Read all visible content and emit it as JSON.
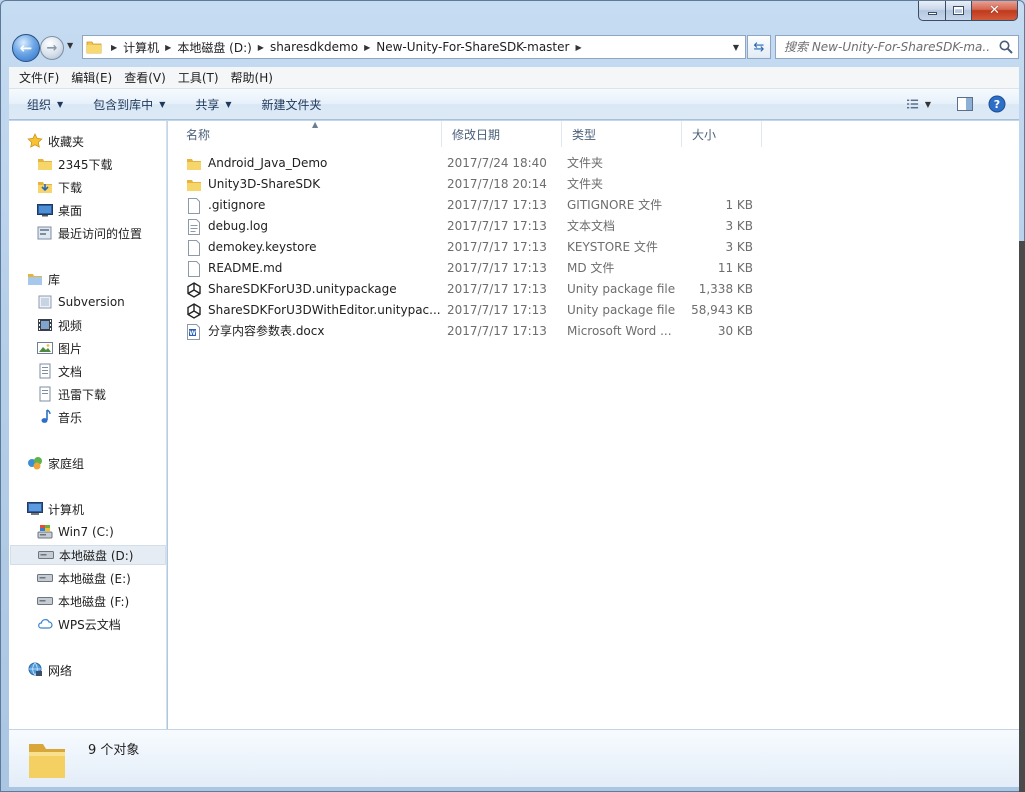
{
  "window": {
    "caption": {
      "minimize": "–",
      "maximize": "□",
      "close": "✕"
    }
  },
  "nav": {
    "back_icon": "back-arrow-icon",
    "forward_icon": "forward-arrow-icon",
    "breadcrumb": [
      "计算机",
      "本地磁盘 (D:)",
      "sharesdkdemo",
      "New-Unity-For-ShareSDK-master"
    ],
    "search_placeholder": "搜索 New-Unity-For-ShareSDK-ma..."
  },
  "menu": [
    "文件(F)",
    "编辑(E)",
    "查看(V)",
    "工具(T)",
    "帮助(H)"
  ],
  "commands": {
    "organize": "组织",
    "include_in_library": "包含到库中",
    "share": "共享",
    "new_folder": "新建文件夹"
  },
  "sidebar": {
    "favorites": {
      "label": "收藏夹",
      "items": [
        {
          "label": "2345下载",
          "icon": "folder-icon"
        },
        {
          "label": "下载",
          "icon": "downloads-folder-icon"
        },
        {
          "label": "桌面",
          "icon": "desktop-icon"
        },
        {
          "label": "最近访问的位置",
          "icon": "recent-places-icon"
        }
      ]
    },
    "libraries": {
      "label": "库",
      "items": [
        {
          "label": "Subversion",
          "icon": "library-icon"
        },
        {
          "label": "视频",
          "icon": "video-icon"
        },
        {
          "label": "图片",
          "icon": "pictures-icon"
        },
        {
          "label": "文档",
          "icon": "documents-icon"
        },
        {
          "label": "迅雷下载",
          "icon": "library-icon"
        },
        {
          "label": "音乐",
          "icon": "music-icon"
        }
      ]
    },
    "homegroup": {
      "label": "家庭组"
    },
    "computer": {
      "label": "计算机",
      "items": [
        {
          "label": "Win7 (C:)",
          "icon": "system-drive-icon"
        },
        {
          "label": "本地磁盘 (D:)",
          "icon": "drive-icon",
          "selected": true
        },
        {
          "label": "本地磁盘 (E:)",
          "icon": "drive-icon"
        },
        {
          "label": "本地磁盘 (F:)",
          "icon": "drive-icon"
        },
        {
          "label": "WPS云文档",
          "icon": "cloud-icon"
        }
      ]
    },
    "network": {
      "label": "网络"
    }
  },
  "columns": {
    "name": "名称",
    "date": "修改日期",
    "type": "类型",
    "size": "大小"
  },
  "files": [
    {
      "name": "Android_Java_Demo",
      "date": "2017/7/24 18:40",
      "type": "文件夹",
      "size": "",
      "icon": "folder-icon"
    },
    {
      "name": "Unity3D-ShareSDK",
      "date": "2017/7/18 20:14",
      "type": "文件夹",
      "size": "",
      "icon": "folder-icon"
    },
    {
      "name": ".gitignore",
      "date": "2017/7/17 17:13",
      "type": "GITIGNORE 文件",
      "size": "1 KB",
      "icon": "file-icon"
    },
    {
      "name": "debug.log",
      "date": "2017/7/17 17:13",
      "type": "文本文档",
      "size": "3 KB",
      "icon": "text-file-icon"
    },
    {
      "name": "demokey.keystore",
      "date": "2017/7/17 17:13",
      "type": "KEYSTORE 文件",
      "size": "3 KB",
      "icon": "file-icon"
    },
    {
      "name": "README.md",
      "date": "2017/7/17 17:13",
      "type": "MD 文件",
      "size": "11 KB",
      "icon": "file-icon"
    },
    {
      "name": "ShareSDKForU3D.unitypackage",
      "date": "2017/7/17 17:13",
      "type": "Unity package file",
      "size": "1,338 KB",
      "icon": "unity-icon"
    },
    {
      "name": "ShareSDKForU3DWithEditor.unitypac...",
      "date": "2017/7/17 17:13",
      "type": "Unity package file",
      "size": "58,943 KB",
      "icon": "unity-icon"
    },
    {
      "name": "分享内容参数表.docx",
      "date": "2017/7/17 17:13",
      "type": "Microsoft Word ...",
      "size": "30 KB",
      "icon": "word-doc-icon"
    }
  ],
  "status": {
    "item_count": "9 个对象"
  }
}
